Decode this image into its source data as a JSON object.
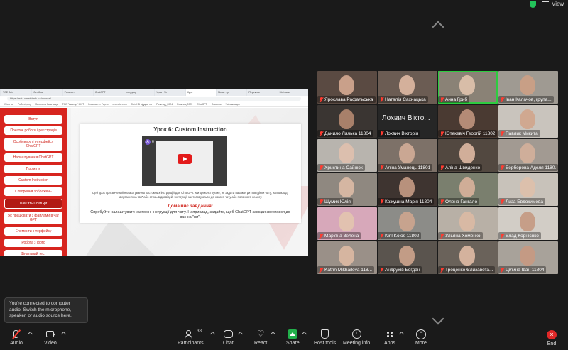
{
  "topbar": {
    "view_label": "View"
  },
  "browser": {
    "tabs": [
      "TOE Звіт",
      "Certifica",
      "Рота за п",
      "ChatGPT",
      "Інструкц",
      "Урок - Уп",
      "Курс",
      "Почат з р",
      "Переклас",
      "Мої каси"
    ],
    "url": "https://edu.umetchnik.ua/course/",
    "bookmarks": [
      "Work ua",
      "Робочі ресу",
      "Загальна база викд",
      "TOE \"Аватар\" МНТ",
      "Главная — Гарна",
      "onenote.com",
      "Звіт НВ віддач, по",
      "Розклад_2024",
      "Розклад 2025",
      "ChatGPT",
      "Словник",
      "Усі закладки"
    ]
  },
  "lesson": {
    "nav": [
      "Вступ",
      "Початок роботи і реєстрація",
      "Особливості інтерфейсу ChatGPT",
      "Налаштування ChatGPT",
      "Промпти",
      "Custom Instruction",
      "Створення зображень",
      "Пам'ять ChatGpt",
      "Як працювати з файлами в чат GPT",
      "Елементи інтерфейсу",
      "Робота з фото",
      "Фінальний тест"
    ],
    "title": "Урок 6: Custom Instruction",
    "video_avatar": "A",
    "video_num": "6",
    "description": "Цей урок присвячений налаштуванню кастомних інструкцій для ChatGPT. Ми демонструємо, як задати параметри поведінки чату, наприклад, звертання на \"ви\" або стиль відповідей. Інструкції застосовуються до нового чату або поточного сеансу.",
    "homework_title": "Домашнє завдання:",
    "homework_text": "Спробуйте налаштувати кастомні інструкції для чату. Наприклад, задайте, щоб ChatGPT завжди звертався до вас на \"ви\"."
  },
  "participants": [
    {
      "name": "Ярослава Рафальська",
      "bg": "#5a4a42",
      "face": "#c9a08a"
    },
    {
      "name": "Наталія Сахнацька",
      "bg": "#6b5c53",
      "face": "#d4b09b"
    },
    {
      "name": "Анна Гриб",
      "bg": "#8a8276",
      "face": "#d8bda8"
    },
    {
      "name": "Іван Калачов, група...",
      "bg": "#9f9a92",
      "face": "#c89f86"
    },
    {
      "name": "Данило Лялька 11804",
      "bg": "#3a3532",
      "face": "#a8806a"
    },
    {
      "name": "Лохвич Вікторія",
      "bg": "#262626",
      "face": "",
      "big": "Лохвич Вікто..."
    },
    {
      "name": "Ютекевіч Георгій 11802",
      "bg": "#4a3a32",
      "face": "#b48b76"
    },
    {
      "name": "Павлик Микита",
      "bg": "#c9c4bd",
      "face": "#d0a890"
    },
    {
      "name": "Христина Сайнюк",
      "bg": "#b8b4ae",
      "face": "#dcbfae"
    },
    {
      "name": "Аліна Уманець 11801",
      "bg": "#7d7168",
      "face": "#caa793"
    },
    {
      "name": "Аліна Швиденко",
      "bg": "#524840",
      "face": "#d1ae99"
    },
    {
      "name": "Берберова Аделя 1180...",
      "bg": "#a29a92",
      "face": "#cfae9a"
    },
    {
      "name": "Шумик Юлія",
      "bg": "#8f8880",
      "face": "#d5b6a2"
    },
    {
      "name": "Кожушна Марія 11804",
      "bg": "#3e3430",
      "face": "#b8917c"
    },
    {
      "name": "Олена Гангало",
      "bg": "#7a7f6e",
      "face": "#d0ad97"
    },
    {
      "name": "Лиза Евдокимова",
      "bg": "#c8c2ba",
      "face": "#dcc0ac"
    },
    {
      "name": "Мар'яна Зелена",
      "bg": "#d7a8ba",
      "face": "#e2c2b0"
    },
    {
      "name": "Kiril Kolos 11802",
      "bg": "#8c8c88",
      "face": "#c7a38e"
    },
    {
      "name": "Ульяна Хоменко",
      "bg": "#b8b0a6",
      "face": "#d8b9a4"
    },
    {
      "name": "Влад Корнієнко",
      "bg": "#d2cdc6",
      "face": "#c69e88"
    },
    {
      "name": "Katrin Mikhailova 118...",
      "bg": "#9a9088",
      "face": "#d6b5a0"
    },
    {
      "name": "Андрухів Богдан",
      "bg": "#5a544e",
      "face": "#c29c86"
    },
    {
      "name": "Троценко Єлизавета...",
      "bg": "#6a625a",
      "face": "#d4b29d"
    },
    {
      "name": "Цілина Іван 11804",
      "bg": "#a8a29a",
      "face": "#c49a84"
    }
  ],
  "active_speaker_index": 2,
  "tooltip": "You're connected to computer audio. Switch the microphone, speaker, or audio source here.",
  "toolbar": {
    "audio": "Audio",
    "video": "Video",
    "participants": "Participants",
    "participant_count": "38",
    "chat": "Chat",
    "react": "React",
    "share": "Share",
    "host_tools": "Host tools",
    "meeting_info": "Meeting info",
    "apps": "Apps",
    "more": "More",
    "end": "End"
  },
  "colors": {
    "accent_red": "#d7251f",
    "share_green": "#22b04b",
    "end_red": "#e02828",
    "active_outline": "#2ecc40"
  }
}
